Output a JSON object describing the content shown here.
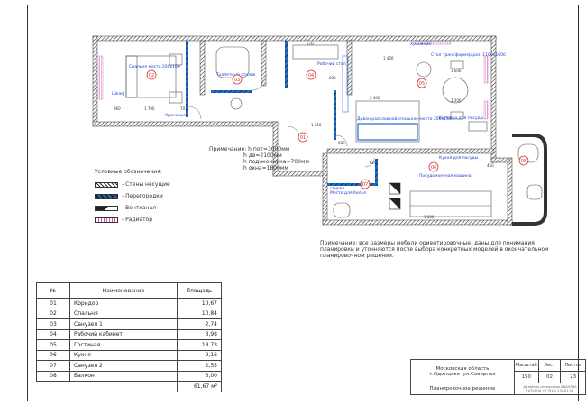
{
  "labels": {
    "bedroom_spec": "Спальня место 200х160",
    "wardrobe": "Шкаф",
    "sofa_spec": "Диван раскладной спальное место 200х150",
    "table_spec": "Стол трансформер раз. 1100х1600",
    "dressing_table": "Туалетный столик",
    "kitchen_set": "Кухня для посуды",
    "storage": "Хранение",
    "work_table": "Рабочий стол",
    "kitchen_module": "Колонна для посуды",
    "washing": "стирка",
    "linen": "Место для белья",
    "shower": "Душ",
    "fridge": "Холодильник",
    "kitchen_cab": "Посудомоечная машина"
  },
  "room_markers": [
    "01",
    "02",
    "03",
    "04",
    "05",
    "06",
    "07",
    "08"
  ],
  "dimensions": {
    "d1": "1 700",
    "d2": "701",
    "d3": "1 540",
    "d4": "960",
    "d5": "1 400",
    "d6": "800",
    "d7": "1 600",
    "d8": "1 200",
    "d9": "2 400",
    "d10": "400",
    "d11": "1 250",
    "d12": "990",
    "d13": "600",
    "d14": "570",
    "d15": "450",
    "d16": "750",
    "d17": "620",
    "d18": "1 800",
    "d19": "600"
  },
  "ceiling_note": {
    "prefix": "Примечание:",
    "h1": "h пот=3000мм",
    "h2": "h дв=2100мм",
    "h3": "h подоконника=700мм",
    "h4": "h окна=1800мм"
  },
  "furniture_note": "Примечание: все размеры мебели ориентировочные, даны для понимания планировки и уточняются после выбора конкретных моделей в окончательном планировочном решении.",
  "legend": {
    "title": "Условные обозначения:",
    "items": [
      {
        "label": "- Стены несущие"
      },
      {
        "label": "- Перегородки"
      },
      {
        "label": "- Вентканал"
      },
      {
        "label": "- Радиатор"
      }
    ]
  },
  "table": {
    "head_num": "№",
    "head_name": "Наименование",
    "head_area": "Площадь",
    "rows": [
      {
        "num": "01",
        "name": "Коридор",
        "area": "10,67"
      },
      {
        "num": "02",
        "name": "Спальня",
        "area": "10,84"
      },
      {
        "num": "03",
        "name": "Санузел 1",
        "area": "2,74"
      },
      {
        "num": "04",
        "name": "Рабочий кабинет",
        "area": "3,98"
      },
      {
        "num": "05",
        "name": "Гостиная",
        "area": "18,73"
      },
      {
        "num": "06",
        "name": "Кухня",
        "area": "9,16"
      },
      {
        "num": "07",
        "name": "Санузел 2",
        "area": "2,55"
      },
      {
        "num": "08",
        "name": "Балкон",
        "area": "3,00"
      }
    ],
    "total": "61,67 м²"
  },
  "stamp": {
    "region": "Московская область",
    "city": "г.Одинцово ,ул.Северная",
    "sheet_title": "Планировочное решение",
    "h_scale": "Масштаб",
    "h_sheet": "Лист",
    "h_sheets": "Листов",
    "scale": "150",
    "sheet": "02",
    "sheets": "23",
    "designer": "Дизайнер интерьеров ИВАНОВА ТАТЬЯНА +7 (916) 232-81-55"
  },
  "colors": {
    "wall": "#333333",
    "partition": "#1b6fd1",
    "radiator": "#d14fb8",
    "marker": "#d43030",
    "annotation": "#1b3fd1"
  }
}
